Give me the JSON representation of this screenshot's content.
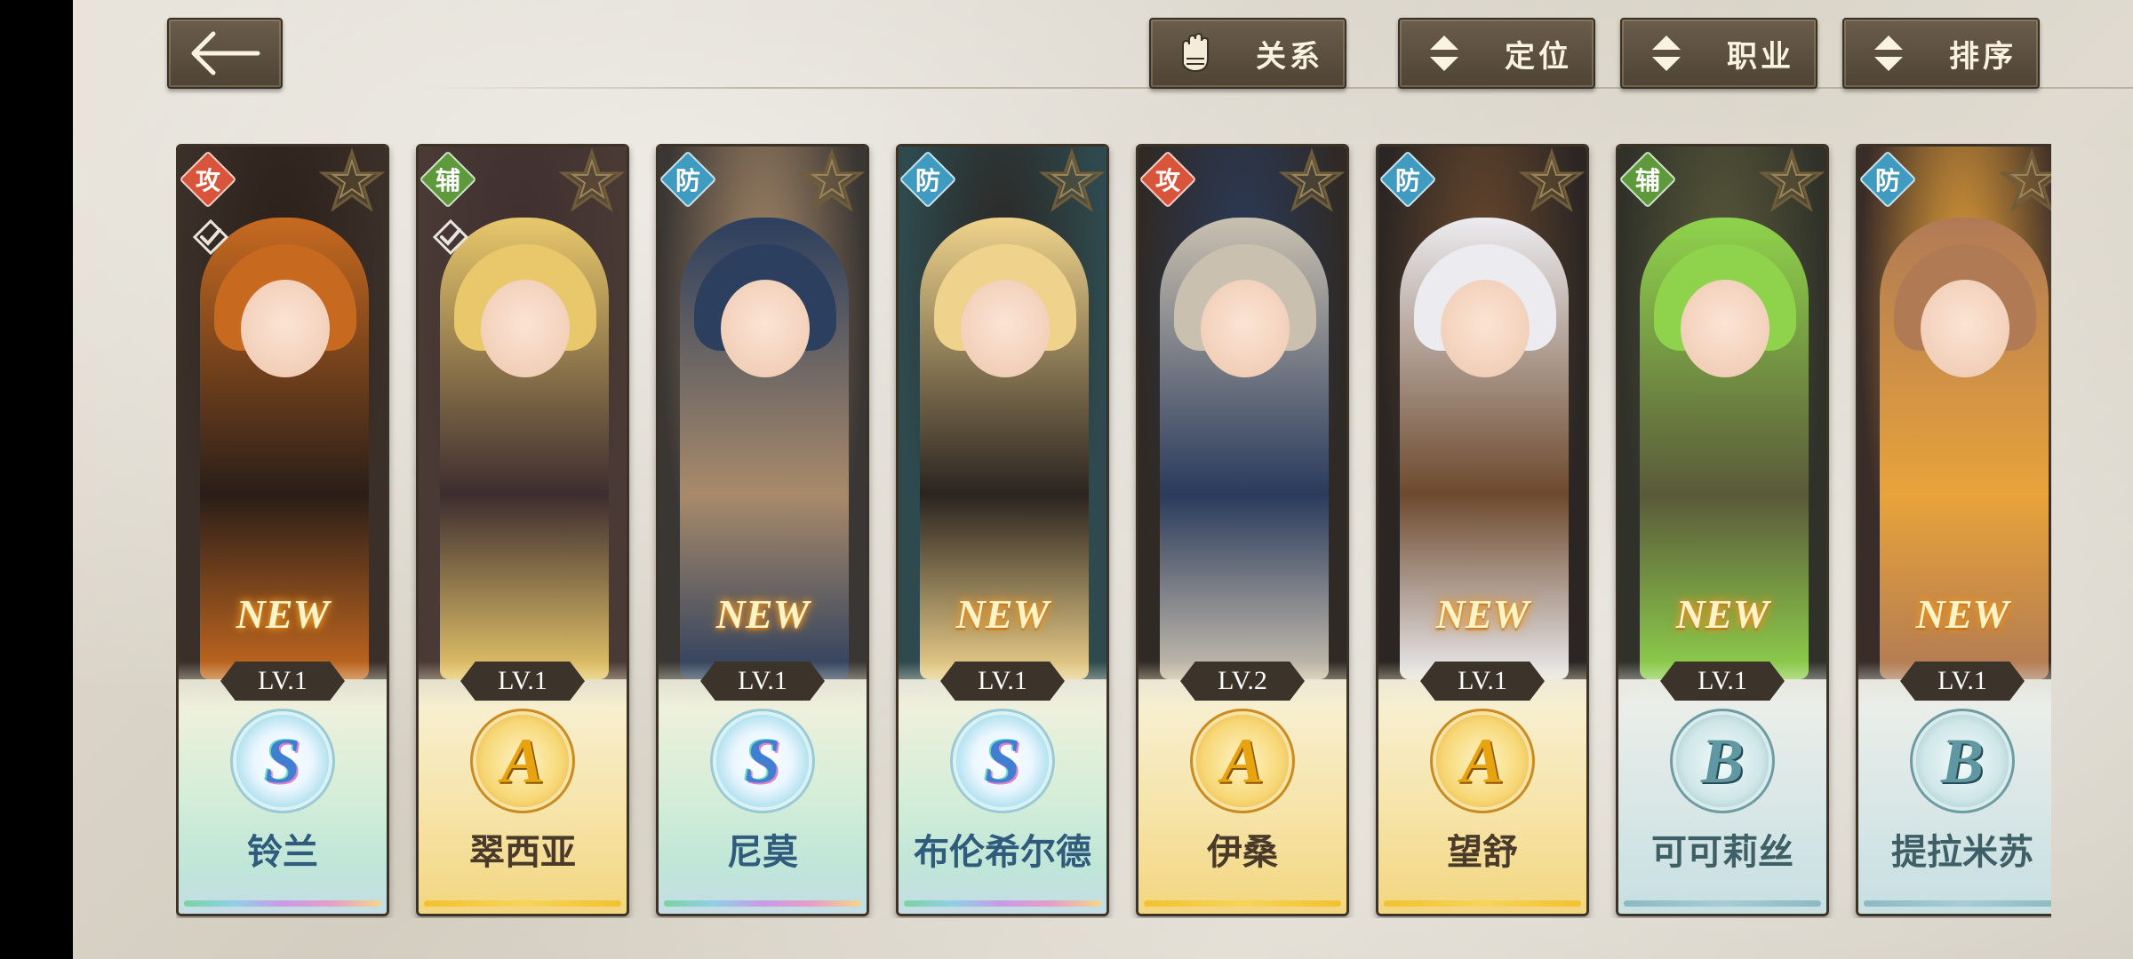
{
  "toolbar": {
    "back_icon": "arrow-left-icon",
    "relation": {
      "label": "关系",
      "icon": "glove-icon"
    },
    "position": {
      "label": "定位",
      "icon": "sort-arrows-icon"
    },
    "job": {
      "label": "职业",
      "icon": "sort-arrows-icon"
    },
    "sort": {
      "label": "排序",
      "icon": "sort-arrows-icon"
    }
  },
  "cards": [
    {
      "role": "攻",
      "role_type": "atk",
      "owned": true,
      "new": "NEW",
      "level": "LV.1",
      "rarity": "S",
      "name": "铃兰",
      "art": [
        "#3a2f29",
        "#c76a20",
        "#2a1e18"
      ]
    },
    {
      "role": "辅",
      "role_type": "sup",
      "owned": true,
      "new": "",
      "level": "LV.1",
      "rarity": "A",
      "name": "翠西亚",
      "art": [
        "#4a3a35",
        "#e8c86b",
        "#3d2d2f"
      ]
    },
    {
      "role": "防",
      "role_type": "def",
      "owned": false,
      "new": "NEW",
      "level": "LV.1",
      "rarity": "S",
      "name": "尼莫",
      "art": [
        "#3a3634",
        "#2c3f5e",
        "#a88a6a"
      ]
    },
    {
      "role": "防",
      "role_type": "def",
      "owned": false,
      "new": "NEW",
      "level": "LV.1",
      "rarity": "S",
      "name": "布伦希尔德",
      "art": [
        "#2e4a4e",
        "#efd38c",
        "#2b2420"
      ]
    },
    {
      "role": "攻",
      "role_type": "atk",
      "owned": false,
      "new": "",
      "level": "LV.2",
      "rarity": "A",
      "name": "伊桑",
      "art": [
        "#2f2a26",
        "#c9c0b0",
        "#2a3b5c"
      ]
    },
    {
      "role": "防",
      "role_type": "def",
      "owned": false,
      "new": "NEW",
      "level": "LV.1",
      "rarity": "A",
      "name": "望舒",
      "art": [
        "#2b2624",
        "#ecebef",
        "#6d4a2e"
      ]
    },
    {
      "role": "辅",
      "role_type": "sup",
      "owned": false,
      "new": "NEW",
      "level": "LV.1",
      "rarity": "B",
      "name": "可可莉丝",
      "art": [
        "#30322a",
        "#8fd34c",
        "#5a5a3a"
      ]
    },
    {
      "role": "防",
      "role_type": "def",
      "owned": false,
      "new": "NEW",
      "level": "LV.1",
      "rarity": "B",
      "name": "提拉米苏",
      "art": [
        "#3a2c28",
        "#b07a55",
        "#e8a33a"
      ]
    }
  ],
  "colors": {
    "role_atk": "#d8543a",
    "role_sup": "#5e9a3c",
    "role_def": "#3f9bc0",
    "button_bg": "#5a4d3d"
  }
}
